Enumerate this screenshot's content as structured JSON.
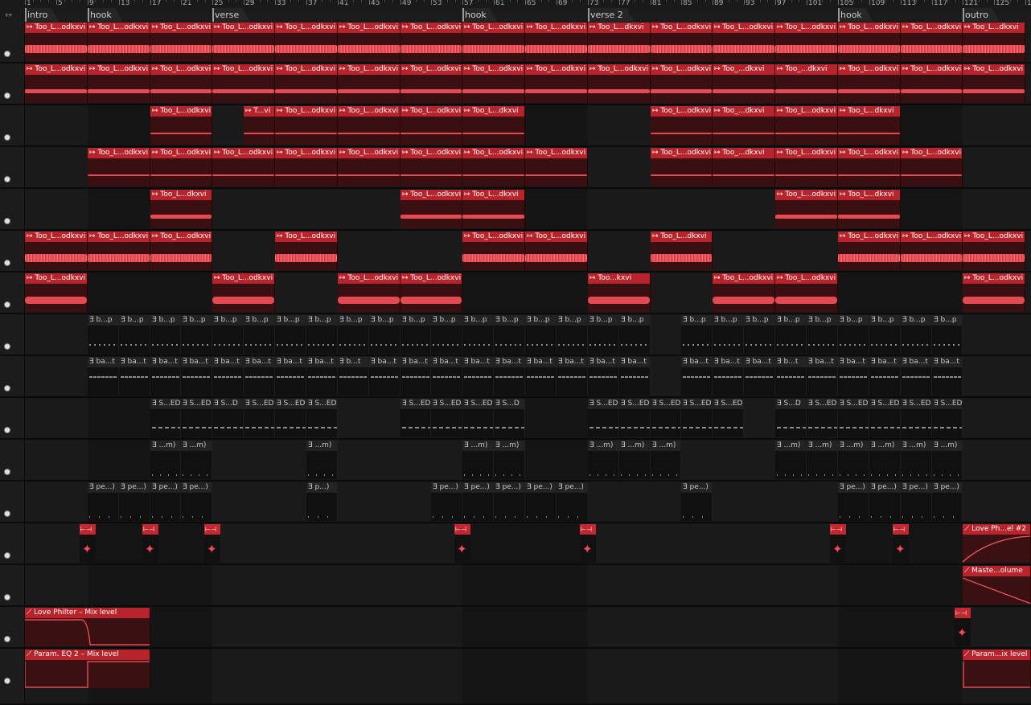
{
  "ruler": {
    "bar_numbers": [
      "1",
      "5",
      "9",
      "13",
      "17",
      "21",
      "25",
      "29",
      "33",
      "37",
      "41",
      "45",
      "49",
      "53",
      "57",
      "61",
      "65",
      "69",
      "73",
      "77",
      "81",
      "85",
      "89",
      "93",
      "97",
      "101",
      "105",
      "109",
      "113",
      "117",
      "121",
      "125",
      "12"
    ]
  },
  "markers": [
    {
      "label": "intro",
      "bar": 1
    },
    {
      "label": "hook",
      "bar": 9
    },
    {
      "label": "verse",
      "bar": 25
    },
    {
      "label": "hook",
      "bar": 57
    },
    {
      "label": "verse 2",
      "bar": 73
    },
    {
      "label": "hook",
      "bar": 105
    },
    {
      "label": "outro",
      "bar": 121
    }
  ],
  "colors": {
    "clip_red": "#b8242c",
    "wave_red": "#e34a52",
    "lane_bg": "#161616",
    "lane_bg_alt": "#1c1c1c"
  },
  "icons": {
    "clip_audio": "arrow-right-bar",
    "clip_midi": "midi-clip",
    "clip_automation": "automation-curve",
    "lane_enable": "circle-dot",
    "ruler_toggle": "double-arrow"
  },
  "clip_names": {
    "full": "Too_L...odkxvi",
    "short_1": "Too_...dkxvi",
    "short_2": "Too_L...dkxvi",
    "short_3": "T...vi",
    "short_4": "Too...kxvi",
    "midi_bp": "b...p",
    "midi_bat": "ba...t",
    "midi_bt": "b...t",
    "midi_sed": "S...ED",
    "midi_sd": "S...D",
    "midi_m": "...m)",
    "midi_pe": "pe...)",
    "midi_p": "p...)",
    "auto_love_phil_2": "Love Ph...el #2",
    "auto_master_volume": "Maste...olume",
    "auto_love_philter_mix": "Love Philter – Mix level",
    "auto_param_eq2_mix": "Param. EQ 2 – Mix level",
    "auto_param_mix": "Param...ix level"
  }
}
